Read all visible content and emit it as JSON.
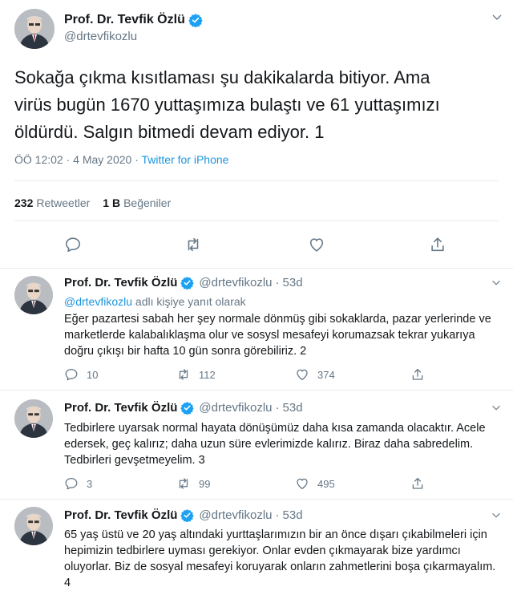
{
  "colors": {
    "text": "#14171a",
    "secondary": "#657786",
    "link": "#1b95e0",
    "border": "#e6ecf0",
    "verified": "#1da1f2"
  },
  "main_tweet": {
    "author_name": "Prof. Dr. Tevfik Özlü",
    "handle": "@drtevfikozlu",
    "text": "Sokağa çıkma kısıtlaması şu dakikalarda bitiyor. Ama\nvirüs bugün 1670 yuttaşımıza bulaştı ve 61 yuttaşımızı\nöldürdü. Salgın bitmedi devam ediyor. 1",
    "timestamp": "ÖÖ 12:02 · 4 May 2020 · ",
    "source": "Twitter for iPhone",
    "retweets_count": "232",
    "retweets_label": "Retweetler",
    "likes_count": "1 B",
    "likes_label": "Beğeniler",
    "icons": [
      "reply-icon",
      "retweet-icon",
      "like-icon",
      "share-icon"
    ]
  },
  "replies": [
    {
      "author_name": "Prof. Dr. Tevfik Özlü",
      "handle": "@drtevfikozlu",
      "dot": "·",
      "age": "53d",
      "replying_mention": "@drtevfikozlu",
      "replying_suffix": " adlı kişiye yanıt olarak",
      "text": "Eğer pazartesi sabah her şey normale dönmüş gibi sokaklarda, pazar yerlerinde ve marketlerde kalabalıklaşma olur ve sosysl mesafeyi korumazsak tekrar yukarıya doğru çıkışı bir hafta 10 gün sonra görebiliriz. 2",
      "reply_count": "10",
      "retweet_count": "112",
      "like_count": "374"
    },
    {
      "author_name": "Prof. Dr. Tevfik Özlü",
      "handle": "@drtevfikozlu",
      "dot": "·",
      "age": "53d",
      "text": "Tedbirlere uyarsak normal hayata dönüşümüz daha kısa zamanda olacaktır. Acele edersek, geç kalırız; daha uzun süre evlerimizde kalırız. Biraz daha sabredelim. Tedbirleri gevşetmeyelim. 3",
      "reply_count": "3",
      "retweet_count": "99",
      "like_count": "495"
    },
    {
      "author_name": "Prof. Dr. Tevfik Özlü",
      "handle": "@drtevfikozlu",
      "dot": "·",
      "age": "53d",
      "text": "65 yaş üstü ve 20 yaş altındaki yurttaşlarımızın bir an önce dışarı çıkabilmeleri için hepimizin tedbirlere uyması gerekiyor. Onlar evden çıkmayarak bize yardımcı oluyorlar. Biz de sosyal mesafeyi koruyarak onların zahmetlerini boşa çıkarmayalım. 4"
    }
  ]
}
